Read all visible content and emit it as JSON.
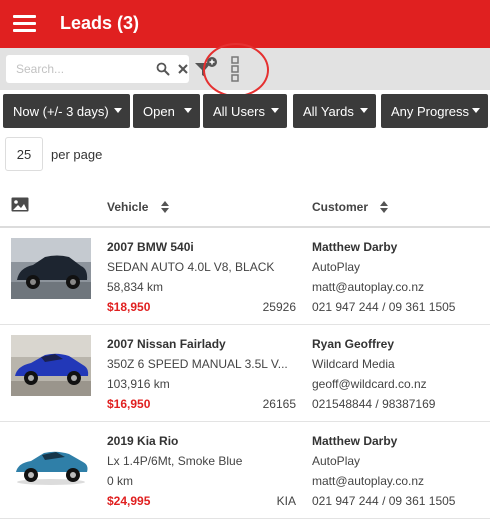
{
  "header": {
    "title": "Leads (3)"
  },
  "search": {
    "placeholder": "Search..."
  },
  "filters": [
    {
      "label": "Now (+/- 3 days)"
    },
    {
      "label": "Open"
    },
    {
      "label": "All Users"
    },
    {
      "label": "All Yards"
    },
    {
      "label": "Any Progress"
    }
  ],
  "paging": {
    "per_page_value": "25",
    "per_page_label": "per page"
  },
  "table": {
    "columns": {
      "vehicle": "Vehicle",
      "customer": "Customer"
    },
    "rows": [
      {
        "title": "2007 BMW 540i",
        "description": "SEDAN AUTO 4.0L V8, BLACK",
        "km": "58,834 km",
        "price": "$18,950",
        "stock": "25926",
        "customer_name": "Matthew Darby",
        "company": "AutoPlay",
        "email": "matt@autoplay.co.nz",
        "phone": "021 947 244 / 09 361 1505",
        "thumb_color": "#1d2530"
      },
      {
        "title": "2007 Nissan Fairlady",
        "description": "350Z 6 SPEED MANUAL 3.5L V...",
        "km": "103,916 km",
        "price": "$16,950",
        "stock": "26165",
        "customer_name": "Ryan Geoffrey",
        "company": "Wildcard Media",
        "email": "geoff@wildcard.co.nz",
        "phone": "021548844 / 98387169",
        "thumb_color": "#2238b8"
      },
      {
        "title": "2019 Kia Rio",
        "description": "Lx 1.4P/6Mt, Smoke Blue",
        "km": "0 km",
        "price": "$24,995",
        "stock": "KIA",
        "customer_name": "Matthew Darby",
        "company": "AutoPlay",
        "email": "matt@autoplay.co.nz",
        "phone": "021 947 244 / 09 361 1505",
        "thumb_color": "#2f7fa8"
      }
    ]
  },
  "colors": {
    "brand": "#e02020",
    "price": "#e02020",
    "filter_bg": "#3b3b3b",
    "highlight": "#e53030"
  },
  "icons": [
    "menu-icon",
    "search-icon",
    "close-icon",
    "filter-add-icon",
    "more-vertical-icon",
    "image-icon",
    "sort-icon"
  ]
}
